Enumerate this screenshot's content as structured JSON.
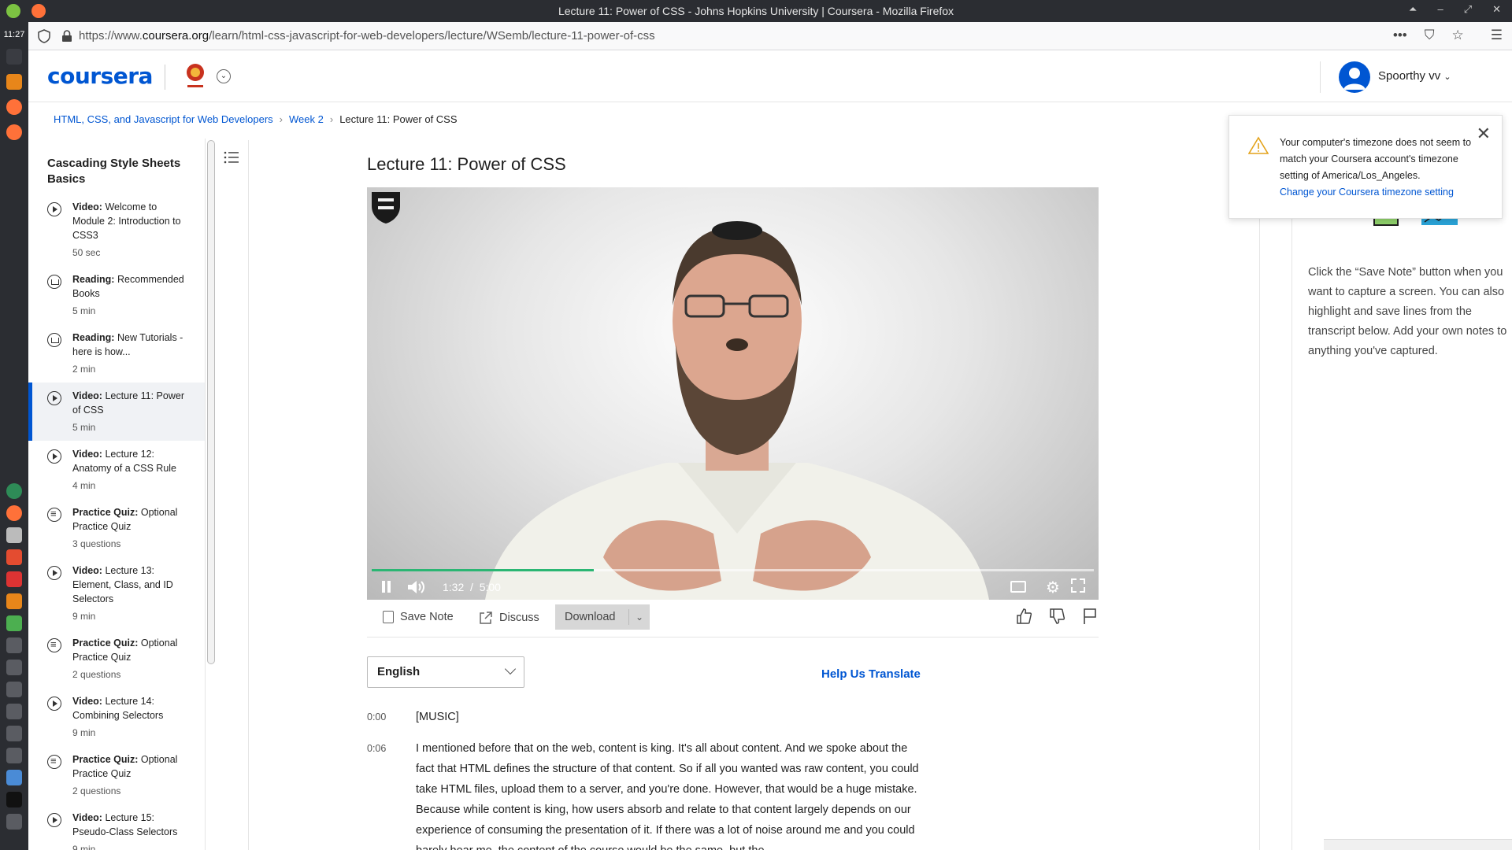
{
  "window": {
    "title": "Lecture 11: Power of CSS - Johns Hopkins University | Coursera - Mozilla Firefox"
  },
  "system": {
    "clock": "11:27"
  },
  "browser": {
    "url_prefix": "https://www.",
    "url_domain": "coursera.org",
    "url_path": "/learn/html-css-javascript-for-web-developers/lecture/WSemb/lecture-11-power-of-css",
    "menu_glyph": "•••"
  },
  "header": {
    "logo": "coursera",
    "user_name": "Spoorthy vv"
  },
  "breadcrumb": {
    "course": "HTML, CSS, and Javascript for Web Developers",
    "week": "Week 2",
    "current": "Lecture 11: Power of CSS",
    "separator": "›"
  },
  "sidebar": {
    "title": "Cascading Style Sheets Basics",
    "items": [
      {
        "type": "Video:",
        "name": "Welcome to Module 2: Introduction to CSS3",
        "meta": "50 sec",
        "icon": "play",
        "active": false
      },
      {
        "type": "Reading:",
        "name": "Recommended Books",
        "meta": "5 min",
        "icon": "read",
        "active": false
      },
      {
        "type": "Reading:",
        "name": "New Tutorials - here is how...",
        "meta": "2 min",
        "icon": "read",
        "active": false
      },
      {
        "type": "Video:",
        "name": "Lecture 11: Power of CSS",
        "meta": "5 min",
        "icon": "play",
        "active": true
      },
      {
        "type": "Video:",
        "name": "Lecture 12: Anatomy of a CSS Rule",
        "meta": "4 min",
        "icon": "play",
        "active": false
      },
      {
        "type": "Practice Quiz:",
        "name": "Optional Practice Quiz",
        "meta": "3 questions",
        "icon": "quiz",
        "active": false
      },
      {
        "type": "Video:",
        "name": "Lecture 13: Element, Class, and ID Selectors",
        "meta": "9 min",
        "icon": "play",
        "active": false
      },
      {
        "type": "Practice Quiz:",
        "name": "Optional Practice Quiz",
        "meta": "2 questions",
        "icon": "quiz",
        "active": false
      },
      {
        "type": "Video:",
        "name": "Lecture 14: Combining Selectors",
        "meta": "9 min",
        "icon": "play",
        "active": false
      },
      {
        "type": "Practice Quiz:",
        "name": "Optional Practice Quiz",
        "meta": "2 questions",
        "icon": "quiz",
        "active": false
      },
      {
        "type": "Video:",
        "name": "Lecture 15: Pseudo-Class Selectors",
        "meta": "9 min",
        "icon": "play",
        "active": false
      }
    ]
  },
  "lecture": {
    "title": "Lecture 11: Power of CSS"
  },
  "video": {
    "current_time": "1:32",
    "time_separator": "/",
    "duration": "5:00",
    "progress_fraction": 0.307,
    "progress_color": "#2bb673"
  },
  "toolbar": {
    "save_note": "Save Note",
    "discuss": "Discuss",
    "download": "Download"
  },
  "transcript": {
    "language": "English",
    "help_translate": "Help Us Translate",
    "lines": [
      {
        "time": "0:00",
        "text": "[MUSIC]"
      },
      {
        "time": "0:06",
        "text": "I mentioned before that on the web, content is king. It's all about content. And we spoke about the fact that HTML defines the structure of that content. So if all you wanted was raw content, you could take HTML files, upload them to a server, and you're done. However, that would be a huge mistake. Because while content is king, how users absorb and relate to that content largely depends on our experience of consuming the presentation of it. If there was a lot of noise around me and you could barely hear me, the content of the course would be the same, but the"
      }
    ]
  },
  "notes": {
    "help_text": "Click the “Save Note” button when you want to capture a screen. You can also highlight and save lines from the transcript below. Add your own notes to anything you've captured."
  },
  "timezone_alert": {
    "message": "Your computer's timezone does not seem to match your Coursera account's timezone setting of America/Los_Angeles.",
    "link": "Change your Coursera timezone setting",
    "close": "✕"
  },
  "colors": {
    "brand": "#0056d2",
    "titlebar": "#2b2d32",
    "accent_green": "#2bb673"
  }
}
